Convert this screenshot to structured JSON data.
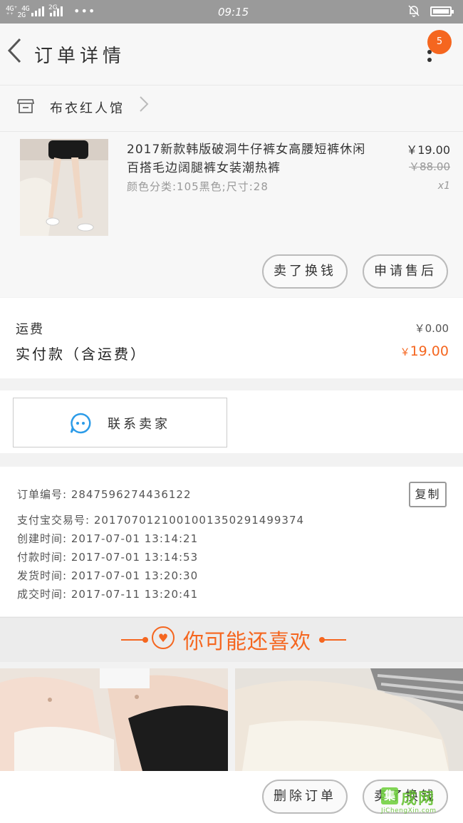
{
  "status_bar": {
    "network_top": "4G⁺ 4G",
    "network_bottom": "⁺⁺ 2G",
    "network_2g": "2G",
    "dots": "•••",
    "time": "09:15"
  },
  "header": {
    "title": "订单详情",
    "badge": "5"
  },
  "shop": {
    "name": "布衣红人馆"
  },
  "product": {
    "name": "2017新款韩版破洞牛仔裤女高腰短裤休闲百搭毛边阔腿裤女装潮热裤",
    "spec": "颜色分类:105黑色;尺寸:28",
    "price": "￥19.00",
    "original_price": "￥88.00",
    "quantity": "x1",
    "buttons": {
      "resell": "卖了换钱",
      "after_sale": "申请售后"
    }
  },
  "totals": {
    "shipping_label": "运费",
    "shipping_value": "￥0.00",
    "paid_label": "实付款（含运费）",
    "paid_currency": "￥",
    "paid_value": "19.00"
  },
  "contact": {
    "label": "联系卖家"
  },
  "order_info": {
    "order_no": "订单编号: 2847596274436122",
    "alipay_no": "支付宝交易号: 2017070121001001350291499374",
    "created": "创建时间: 2017-07-01 13:14:21",
    "paid": "付款时间: 2017-07-01 13:14:53",
    "shipped": "发货时间: 2017-07-01 13:20:30",
    "completed": "成交时间: 2017-07-11 13:20:41",
    "copy_label": "复制"
  },
  "recommend": {
    "title": "你可能还喜欢"
  },
  "bottom_bar": {
    "delete_label": "删除订单",
    "resell_label": "卖了换钱"
  },
  "watermark": {
    "logo_letter": "集",
    "text": "成网",
    "url": "JiChengXin.com"
  },
  "colors": {
    "accent": "#f5661f",
    "contact_icon": "#2b9be8",
    "watermark": "#5fbf2a"
  }
}
